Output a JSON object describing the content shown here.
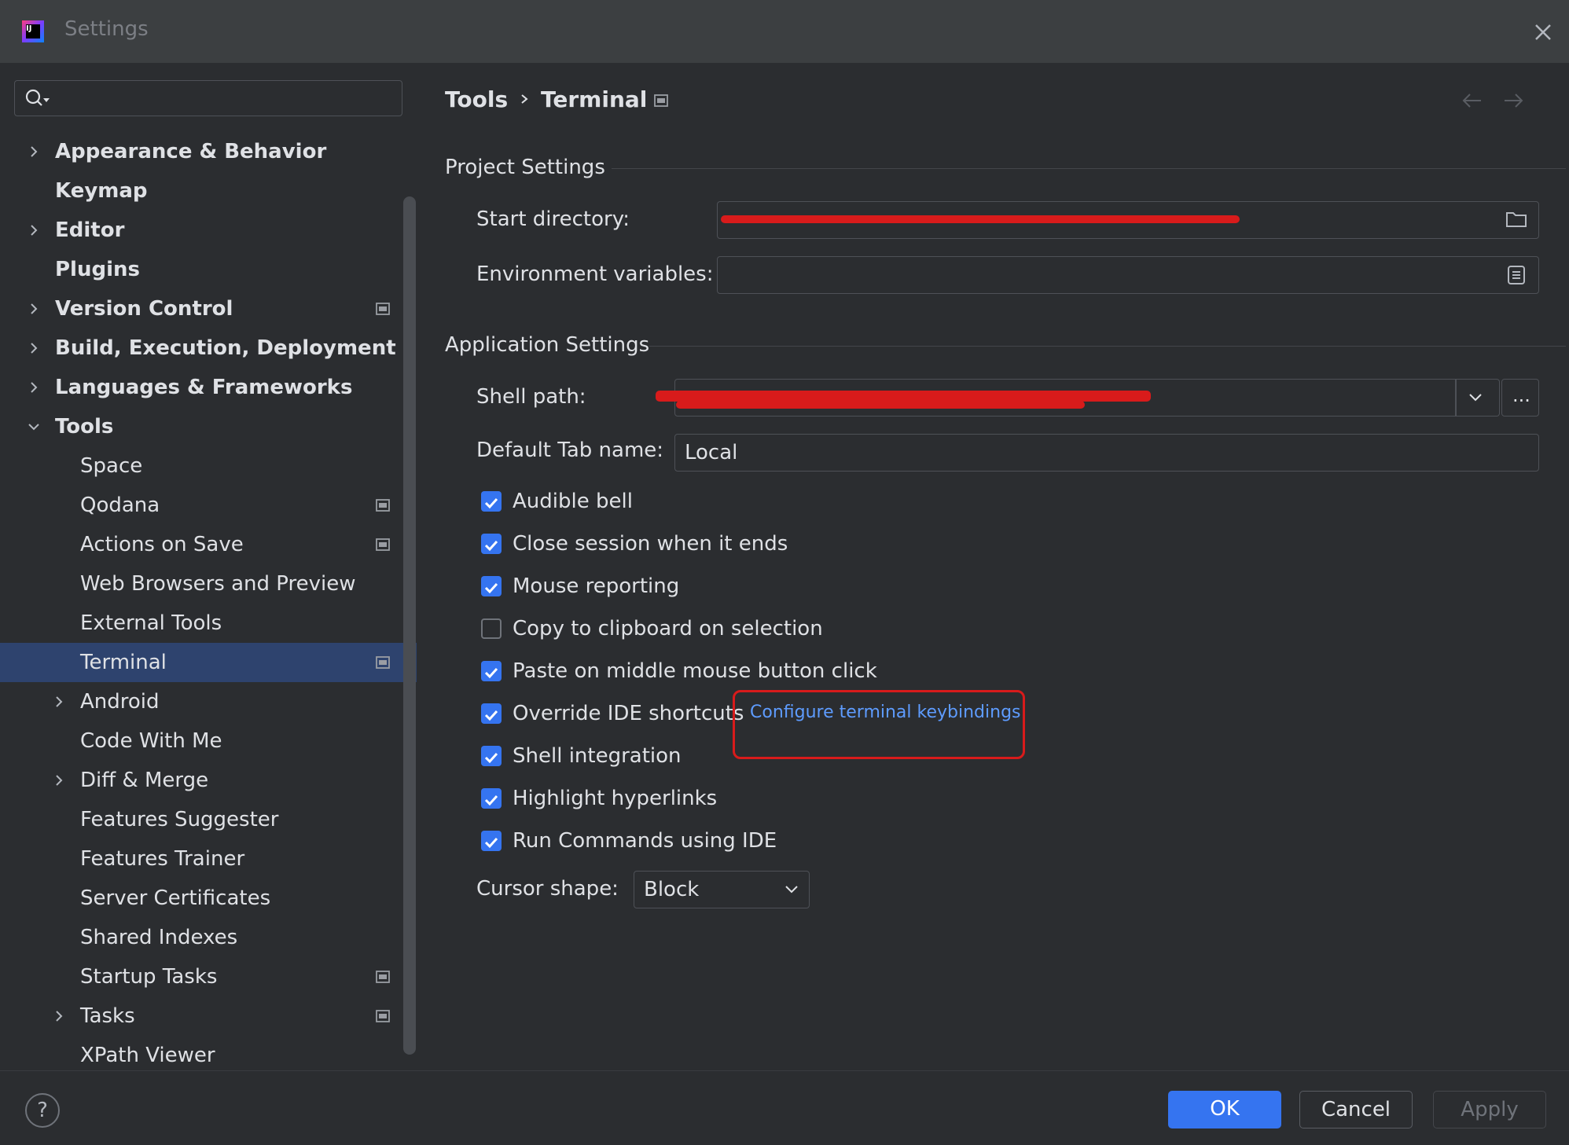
{
  "window": {
    "title": "Settings"
  },
  "search": {
    "placeholder": ""
  },
  "tree": [
    {
      "label": "Appearance & Behavior",
      "expandable": true,
      "expanded": false,
      "level": 0,
      "project_icon": false
    },
    {
      "label": "Keymap",
      "expandable": false,
      "level": 0,
      "project_icon": false
    },
    {
      "label": "Editor",
      "expandable": true,
      "expanded": false,
      "level": 0,
      "project_icon": false
    },
    {
      "label": "Plugins",
      "expandable": false,
      "level": 0,
      "project_icon": false
    },
    {
      "label": "Version Control",
      "expandable": true,
      "expanded": false,
      "level": 0,
      "project_icon": true
    },
    {
      "label": "Build, Execution, Deployment",
      "expandable": true,
      "expanded": false,
      "level": 0,
      "project_icon": false
    },
    {
      "label": "Languages & Frameworks",
      "expandable": true,
      "expanded": false,
      "level": 0,
      "project_icon": false
    },
    {
      "label": "Tools",
      "expandable": true,
      "expanded": true,
      "level": 0,
      "project_icon": false
    },
    {
      "label": "Space",
      "expandable": false,
      "level": 1,
      "project_icon": false
    },
    {
      "label": "Qodana",
      "expandable": false,
      "level": 1,
      "project_icon": true
    },
    {
      "label": "Actions on Save",
      "expandable": false,
      "level": 1,
      "project_icon": true
    },
    {
      "label": "Web Browsers and Preview",
      "expandable": false,
      "level": 1,
      "project_icon": false
    },
    {
      "label": "External Tools",
      "expandable": false,
      "level": 1,
      "project_icon": false
    },
    {
      "label": "Terminal",
      "expandable": false,
      "level": 1,
      "project_icon": true,
      "selected": true
    },
    {
      "label": "Android",
      "expandable": true,
      "expanded": false,
      "level": 1,
      "project_icon": false
    },
    {
      "label": "Code With Me",
      "expandable": false,
      "level": 1,
      "project_icon": false
    },
    {
      "label": "Diff & Merge",
      "expandable": true,
      "expanded": false,
      "level": 1,
      "project_icon": false
    },
    {
      "label": "Features Suggester",
      "expandable": false,
      "level": 1,
      "project_icon": false
    },
    {
      "label": "Features Trainer",
      "expandable": false,
      "level": 1,
      "project_icon": false
    },
    {
      "label": "Server Certificates",
      "expandable": false,
      "level": 1,
      "project_icon": false
    },
    {
      "label": "Shared Indexes",
      "expandable": false,
      "level": 1,
      "project_icon": false
    },
    {
      "label": "Startup Tasks",
      "expandable": false,
      "level": 1,
      "project_icon": true
    },
    {
      "label": "Tasks",
      "expandable": true,
      "expanded": false,
      "level": 1,
      "project_icon": true
    },
    {
      "label": "XPath Viewer",
      "expandable": false,
      "level": 1,
      "project_icon": false
    }
  ],
  "breadcrumb": {
    "parent": "Tools",
    "current": "Terminal"
  },
  "project_settings": {
    "title": "Project Settings",
    "start_directory_label": "Start directory:",
    "start_directory_value": "",
    "env_vars_label": "Environment variables:",
    "env_vars_value": ""
  },
  "application_settings": {
    "title": "Application Settings",
    "shell_path_label": "Shell path:",
    "shell_path_value": "",
    "default_tab_label": "Default Tab name:",
    "default_tab_value": "Local",
    "checkboxes": [
      {
        "label": "Audible bell",
        "checked": true
      },
      {
        "label": "Close session when it ends",
        "checked": true
      },
      {
        "label": "Mouse reporting",
        "checked": true
      },
      {
        "label": "Copy to clipboard on selection",
        "checked": false
      },
      {
        "label": "Paste on middle mouse button click",
        "checked": true
      },
      {
        "label": "Override IDE shortcuts",
        "checked": true
      },
      {
        "label": "Shell integration",
        "checked": true
      },
      {
        "label": "Highlight hyperlinks",
        "checked": true
      },
      {
        "label": "Run Commands using IDE",
        "checked": true
      }
    ],
    "keybindings_link": "Configure terminal keybindings",
    "cursor_shape_label": "Cursor shape:",
    "cursor_shape_value": "Block"
  },
  "footer": {
    "help_label": "?",
    "ok_label": "OK",
    "cancel_label": "Cancel",
    "apply_label": "Apply"
  },
  "colors": {
    "background": "#2b2d30",
    "titlebar": "#3c3f41",
    "accent": "#3574f0",
    "selection": "#2e436e",
    "link": "#5e9cff",
    "annotation": "#d81b1b"
  }
}
